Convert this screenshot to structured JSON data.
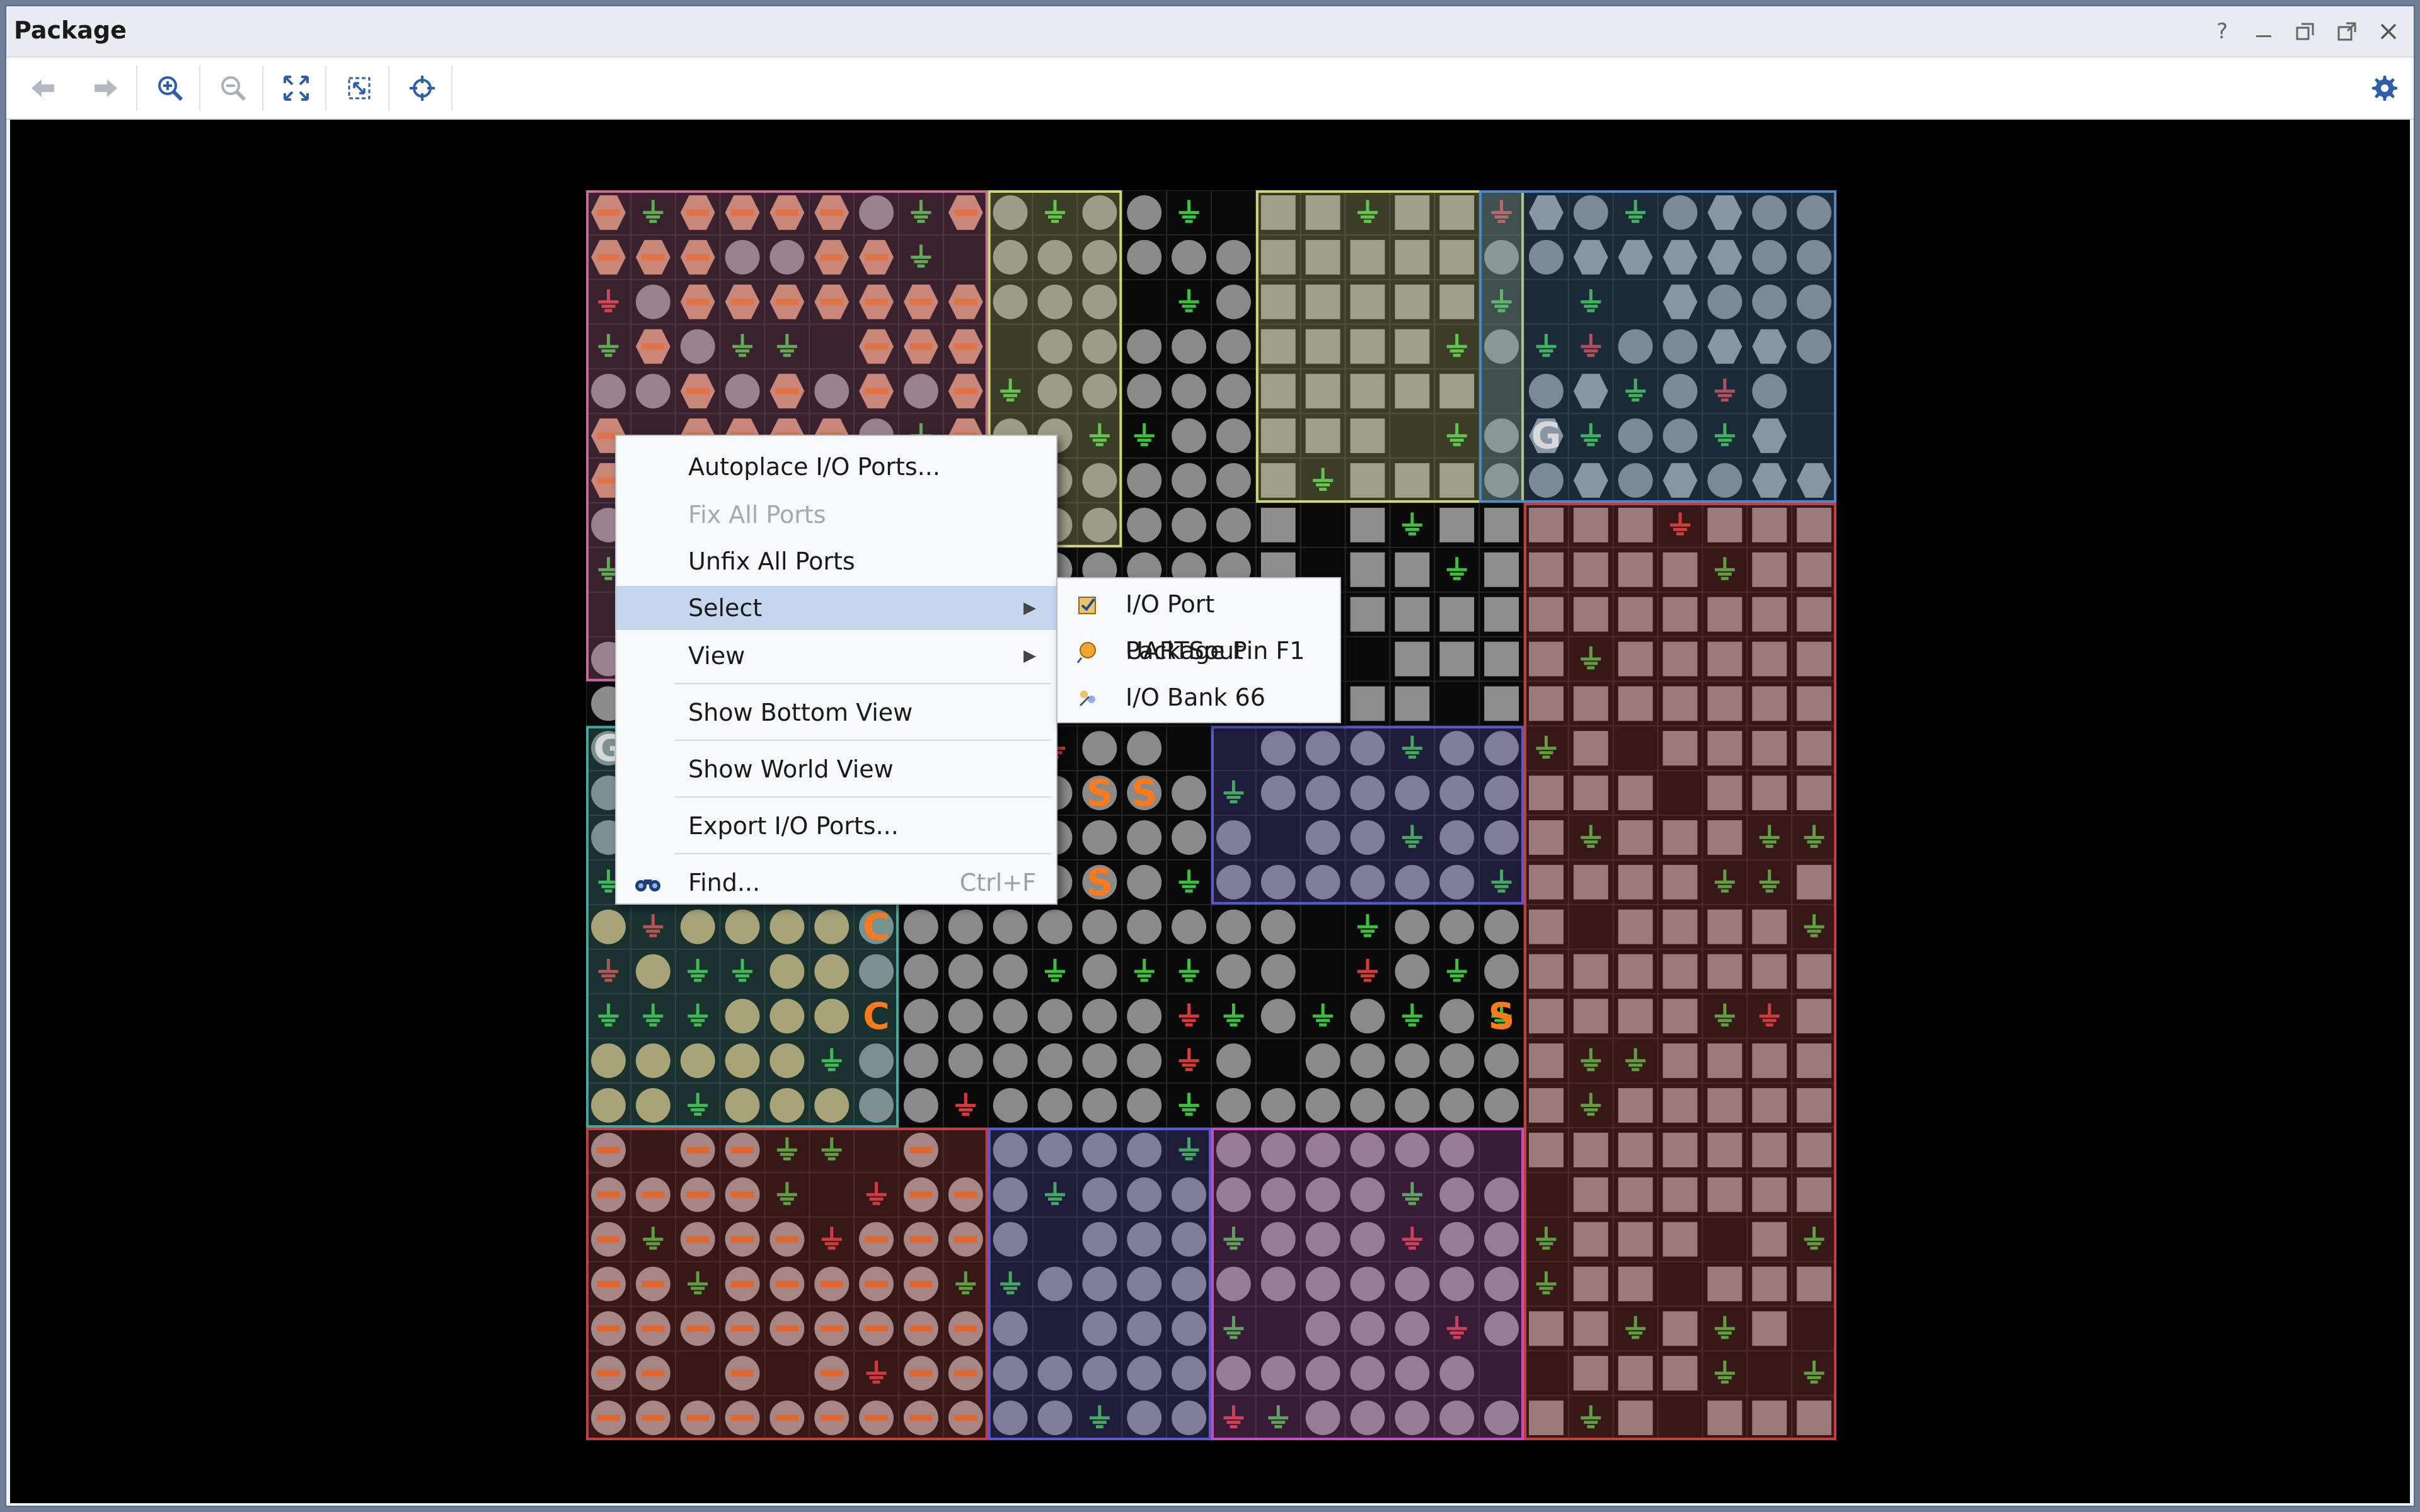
{
  "window": {
    "title": "Package",
    "controls": [
      "help-icon",
      "minimize-icon",
      "restore-icon",
      "maximize-icon",
      "close-icon"
    ]
  },
  "toolbar": {
    "buttons": [
      "back-arrow-icon",
      "forward-arrow-icon",
      "zoom-in-icon",
      "zoom-out-icon",
      "zoom-fit-icon",
      "zoom-selection-icon",
      "autofit-target-icon"
    ],
    "settings_icon": "gear-icon"
  },
  "package_view": {
    "bank_labels": [
      "G",
      "G",
      "C",
      "C",
      "S",
      "S",
      "S",
      "S"
    ]
  },
  "context_menu": {
    "items": [
      {
        "label": "Autoplace I/O Ports...",
        "enabled": true
      },
      {
        "label": "Fix All Ports",
        "enabled": false
      },
      {
        "label": "Unfix All Ports",
        "enabled": true
      },
      {
        "label": "Select",
        "enabled": true,
        "submenu": true,
        "highlighted": true
      },
      {
        "label": "View",
        "enabled": true,
        "submenu": true
      },
      {
        "label": "Show Bottom View",
        "enabled": true
      },
      {
        "label": "Show World View",
        "enabled": true
      },
      {
        "label": "Export I/O Ports...",
        "enabled": true
      },
      {
        "label": "Find...",
        "enabled": true,
        "shortcut": "Ctrl+F",
        "icon": "binoculars-icon"
      }
    ]
  },
  "select_submenu": {
    "items": [
      {
        "label": "I/O Port UARTSout",
        "icon": "io-port-icon"
      },
      {
        "label": "Package Pin F1",
        "icon": "package-pin-icon"
      },
      {
        "label": "I/O Bank 66",
        "icon": "io-bank-icon"
      }
    ]
  },
  "colors": {
    "accent": "#c7d6ef",
    "canvas_bg": "#000000",
    "bank_pink": "#c86a9a",
    "bank_yellow": "#cfd67a",
    "bank_blue": "#4a8ac8",
    "bank_red": "#c04040",
    "bank_teal": "#48a8a0"
  }
}
